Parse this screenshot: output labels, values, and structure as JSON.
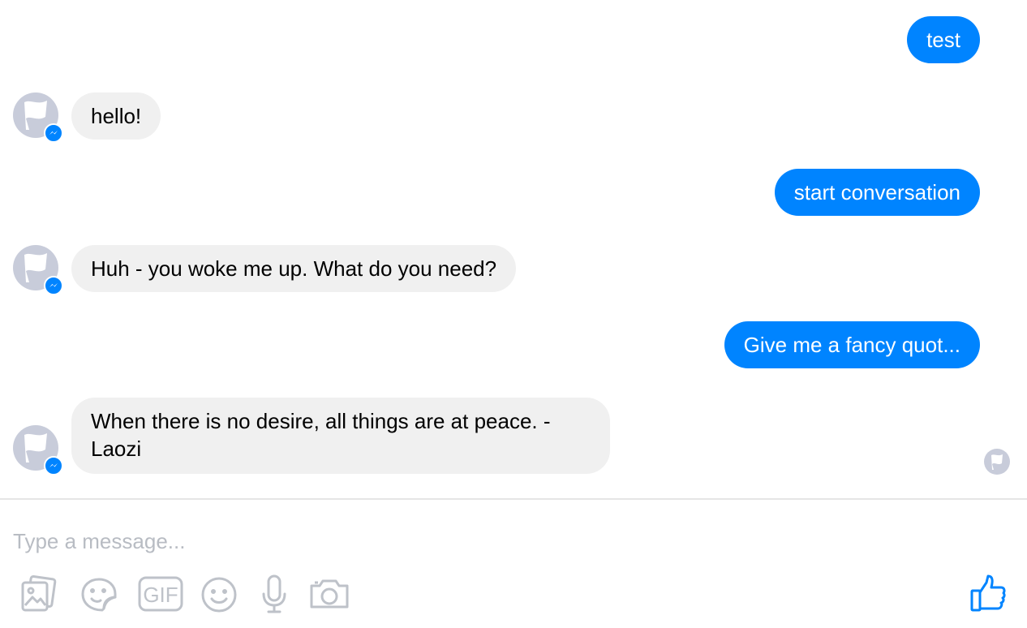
{
  "messages": [
    {
      "direction": "outgoing",
      "text": "test"
    },
    {
      "direction": "incoming",
      "text": "hello!"
    },
    {
      "direction": "outgoing",
      "text": "start conversation"
    },
    {
      "direction": "incoming",
      "text": "Huh - you woke me up. What do you need?"
    },
    {
      "direction": "outgoing",
      "text": "Give me a fancy quot..."
    },
    {
      "direction": "incoming",
      "text": "When there is no desire, all things are at peace. - Laozi"
    }
  ],
  "composer": {
    "placeholder": "Type a message...",
    "tools": [
      "photo-icon",
      "sticker-icon",
      "gif-icon",
      "emoji-icon",
      "microphone-icon",
      "camera-icon"
    ],
    "gif_label": "GIF",
    "send_icon": "thumbs-up-icon"
  },
  "colors": {
    "outgoing_bubble": "#0084ff",
    "incoming_bubble": "#f0f0f0",
    "avatar": "#c8ccda",
    "icon_gray": "#bec2c9"
  }
}
